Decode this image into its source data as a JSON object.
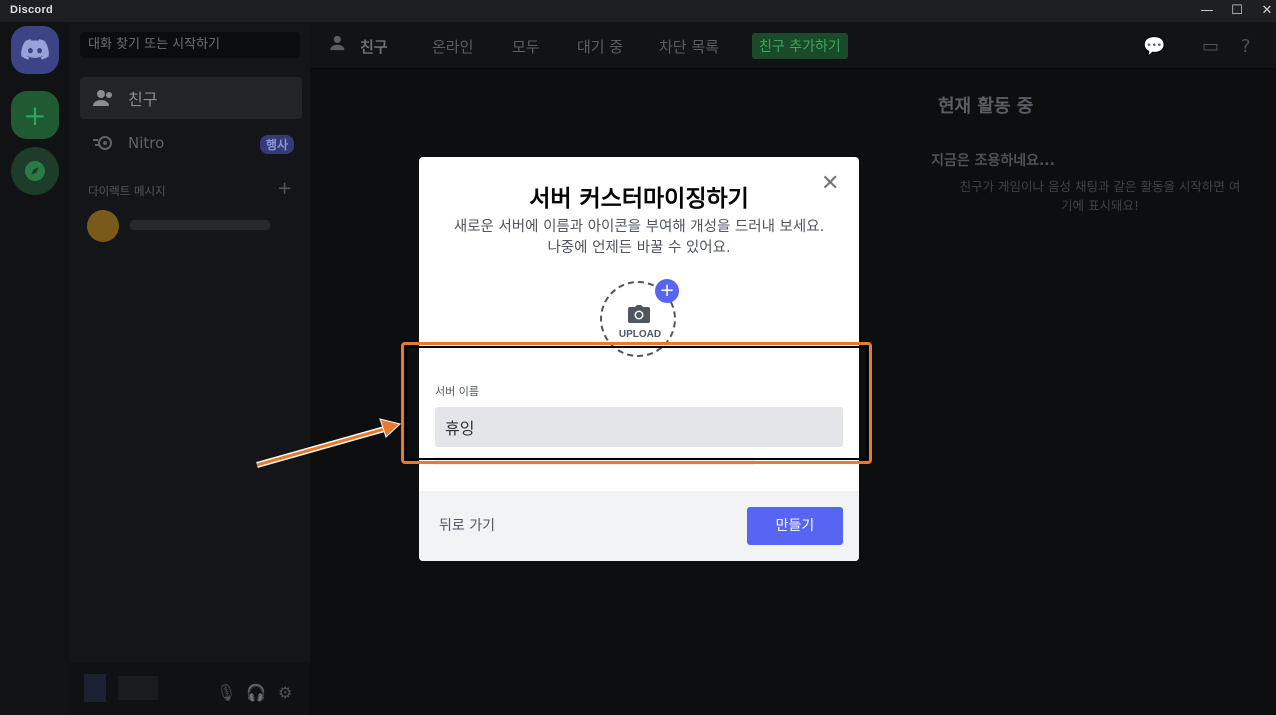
{
  "window": {
    "app_name": "Discord",
    "minimize": "—",
    "maximize": "☐",
    "close": "✕"
  },
  "sidebar": {
    "search_placeholder": "대화 찾기 또는 시작하기",
    "friends_label": "친구",
    "nitro_label": "Nitro",
    "nitro_badge": "행사",
    "dm_header": "다이렉트 메시지",
    "dm_add": "+"
  },
  "topbar": {
    "title": "친구",
    "tabs": [
      "온라인",
      "모두",
      "대기 중",
      "차단 목록"
    ],
    "add_friend": "친구 추가하기"
  },
  "activity": {
    "title": "현재 활동 중",
    "quiet_title": "지금은 조용하네요...",
    "quiet_desc": "친구가 게임이나 음성 채팅과 같은 활동을 시작하면 여기에 표시돼요!"
  },
  "modal": {
    "title": "서버 커스터마이징하기",
    "description": "새로운 서버에 이름과 아이콘을 부여해 개성을 드러내 보세요. 나중에 언제든 바꿀 수 있어요.",
    "upload_label": "UPLOAD",
    "upload_plus": "+",
    "server_name_label": "서버 이름",
    "server_name_value": "휴잉",
    "back_label": "뒤로 가기",
    "create_label": "만들기",
    "close": "✕"
  },
  "colors": {
    "accent": "#5865f2",
    "highlight": "#e87a2d",
    "green": "#3aa55d"
  }
}
